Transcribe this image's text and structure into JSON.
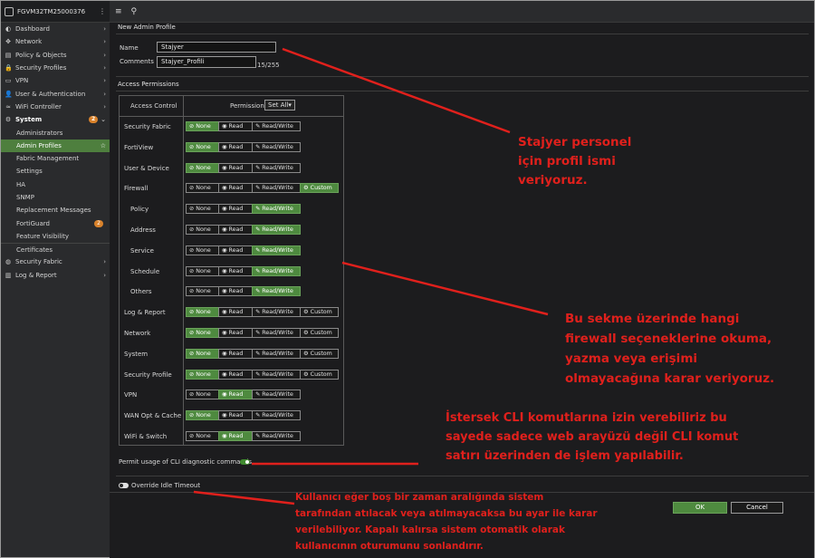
{
  "sidebar": {
    "device": "FGVM32TM25000376",
    "items": [
      {
        "icon": "dashboard-icon",
        "glyph": "◐",
        "label": "Dashboard",
        "arrow": "›"
      },
      {
        "icon": "network-icon",
        "glyph": "✥",
        "label": "Network",
        "arrow": "›"
      },
      {
        "icon": "policy-icon",
        "glyph": "▤",
        "label": "Policy & Objects",
        "arrow": "›"
      },
      {
        "icon": "lock-icon",
        "glyph": "🔒",
        "label": "Security Profiles",
        "arrow": "›"
      },
      {
        "icon": "vpn-icon",
        "glyph": "▭",
        "label": "VPN",
        "arrow": "›"
      },
      {
        "icon": "user-icon",
        "glyph": "👤",
        "label": "User & Authentication",
        "arrow": "›"
      },
      {
        "icon": "wifi-icon",
        "glyph": "≈",
        "label": "WiFi Controller",
        "arrow": "›"
      },
      {
        "icon": "gear-icon",
        "glyph": "⚙",
        "label": "System",
        "badge": "2",
        "arrow": "⌄"
      }
    ],
    "system_sub": [
      {
        "label": "Administrators"
      },
      {
        "label": "Admin Profiles",
        "star": "☆"
      },
      {
        "label": "Fabric Management"
      },
      {
        "label": "Settings"
      },
      {
        "label": "HA"
      },
      {
        "label": "SNMP"
      },
      {
        "label": "Replacement Messages"
      },
      {
        "label": "FortiGuard",
        "badge": "2"
      },
      {
        "label": "Feature Visibility"
      },
      {
        "label": "Certificates"
      }
    ],
    "bottom_items": [
      {
        "icon": "security-fabric-icon",
        "glyph": "◍",
        "label": "Security Fabric",
        "arrow": "›"
      },
      {
        "icon": "log-report-icon",
        "glyph": "▥",
        "label": "Log & Report",
        "arrow": "›"
      }
    ]
  },
  "topbar": {
    "menu_glyph": "≡",
    "search_glyph": "⚲"
  },
  "form": {
    "title": "New Admin Profile",
    "name_label": "Name",
    "name_value": "Stajyer",
    "comments_label": "Comments",
    "comments_value": "Stajyer_Profili",
    "counter": "15/255",
    "access_title": "Access Permissions",
    "col_access": "Access Control",
    "col_permissions": "Permissions",
    "set_all": "Set All",
    "labels": {
      "none": "None",
      "read": "Read",
      "rw": "Read/Write",
      "custom": "Custom"
    },
    "glyphs": {
      "none": "⊘",
      "read": "◉",
      "rw": "✎",
      "custom": "⚙"
    },
    "rows": [
      {
        "label": "Security Fabric",
        "sel": "none",
        "custom": false,
        "sub": false
      },
      {
        "label": "FortiView",
        "sel": "none",
        "custom": false,
        "sub": false
      },
      {
        "label": "User & Device",
        "sel": "none",
        "custom": false,
        "sub": false
      },
      {
        "label": "Firewall",
        "sel": "custom",
        "custom": true,
        "sub": false
      },
      {
        "label": "Policy",
        "sel": "rw",
        "custom": false,
        "sub": true
      },
      {
        "label": "Address",
        "sel": "rw",
        "custom": false,
        "sub": true
      },
      {
        "label": "Service",
        "sel": "rw",
        "custom": false,
        "sub": true
      },
      {
        "label": "Schedule",
        "sel": "rw",
        "custom": false,
        "sub": true
      },
      {
        "label": "Others",
        "sel": "rw",
        "custom": false,
        "sub": true
      },
      {
        "label": "Log & Report",
        "sel": "none",
        "custom": true,
        "sub": false
      },
      {
        "label": "Network",
        "sel": "none",
        "custom": true,
        "sub": false
      },
      {
        "label": "System",
        "sel": "none",
        "custom": true,
        "sub": false
      },
      {
        "label": "Security Profile",
        "sel": "none",
        "custom": true,
        "sub": false
      },
      {
        "label": "VPN",
        "sel": "read",
        "custom": false,
        "sub": false
      },
      {
        "label": "WAN Opt & Cache",
        "sel": "none",
        "custom": false,
        "sub": false
      },
      {
        "label": "WiFi & Switch",
        "sel": "read",
        "custom": false,
        "sub": false
      }
    ],
    "cli_label": "Permit usage of CLI diagnostic commands",
    "cli_enabled": true,
    "idle_label": "Override Idle Timeout",
    "idle_enabled": false,
    "ok_label": "OK",
    "cancel_label": "Cancel"
  },
  "annotations": {
    "name_note": [
      "Stajyer personel",
      "için profil ismi",
      "veriyoruz."
    ],
    "firewall_note": [
      "Bu sekme üzerinde hangi",
      "firewall seçeneklerine okuma,",
      "yazma veya erişimi",
      "olmayacağına karar veriyoruz."
    ],
    "cli_note": [
      "İstersek CLI komutlarına izin verebiliriz bu",
      "sayede sadece web arayüzü değil CLI komut",
      "satırı üzerinden de işlem yapılabilir."
    ],
    "idle_note": [
      "Kullanıcı eğer boş bir zaman aralığında sistem",
      "tarafından atılacak veya atılmayacaksa bu ayar ile karar",
      "verilebiliyor. Kapalı kalırsa sistem otomatik olarak",
      "kullanıcının oturumunu sonlandırır."
    ]
  },
  "colors": {
    "accent": "#4e8a3f",
    "annotation": "#e0201c",
    "background": "#1c1c1e",
    "sidebar": "#2a2b2d"
  }
}
